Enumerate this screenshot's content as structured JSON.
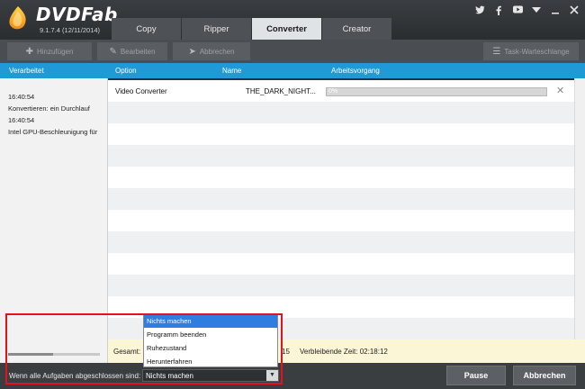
{
  "app": {
    "logo": "DVDFab",
    "version": "9.1.7.4 (12/11/2014)"
  },
  "tabs": [
    {
      "label": "Copy",
      "active": false
    },
    {
      "label": "Ripper",
      "active": false
    },
    {
      "label": "Converter",
      "active": true
    },
    {
      "label": "Creator",
      "active": false
    }
  ],
  "header_icons": [
    "twitter-icon",
    "facebook-icon",
    "youtube-icon",
    "menu-down-icon",
    "minimize-icon",
    "close-icon"
  ],
  "toolbar": {
    "add_label": "Hinzufügen",
    "edit_label": "Bearbeiten",
    "start_label": "Abbrechen",
    "queue_label": "Task-Warteschlange"
  },
  "left_panel": {
    "header": "Verarbeitet",
    "log": [
      "16:40:54",
      "Konvertieren: ein Durchlauf",
      "16:40:54",
      "Intel GPU-Beschleunigung für"
    ]
  },
  "table": {
    "columns": [
      "Option",
      "Name",
      "Arbeitsvorgang"
    ],
    "rows": [
      {
        "option": "Video Converter",
        "name": "THE_DARK_NIGHT...",
        "progress_label": "0%",
        "progress": 0
      }
    ]
  },
  "summary": {
    "total_label": "Gesamt:",
    "elapsed_fragment": "15",
    "remaining": "Verbleibende Zeit: 02:18:12"
  },
  "footer": {
    "completion_label": "Wenn alle Aufgaben abgeschlossen sind:",
    "selected_option": "Nichts machen",
    "pause_label": "Pause",
    "cancel_label": "Abbrechen"
  },
  "dropdown": {
    "options": [
      "Nichts machen",
      "Programm beenden",
      "Ruhezustand",
      "Herunterfahren"
    ],
    "selected_index": 0
  },
  "colors": {
    "accent": "#1f9ad6",
    "selection": "#2f7de1",
    "highlight": "#e0141e",
    "summary_bg": "#fbf7d6"
  }
}
